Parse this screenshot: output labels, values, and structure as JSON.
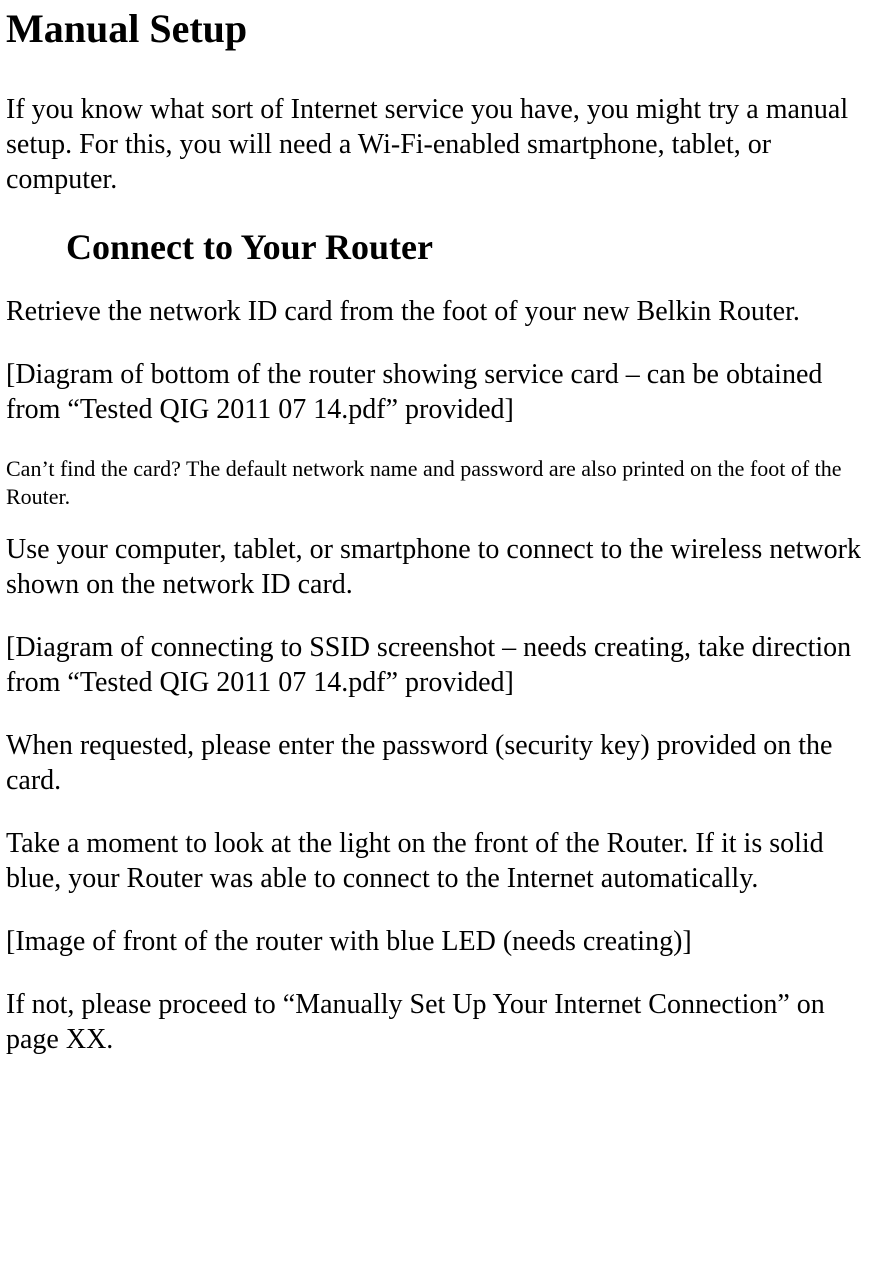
{
  "title": "Manual Setup",
  "intro": "If you know what sort of Internet service you have, you might try a manual setup. For this, you will need a Wi-Fi-enabled smartphone, tablet, or computer.",
  "section_heading": "Connect to Your Router",
  "para1": "Retrieve the network ID card from the foot of your new Belkin Router.",
  "para2": "[Diagram of bottom of the router showing service card – can be obtained from “Tested QIG 2011 07 14.pdf” provided]",
  "note": "Can’t find the card? The default network name and password are also printed on the foot of the Router.",
  "para3": "Use your computer, tablet, or smartphone to connect to the wireless network shown on the network ID card.",
  "para4": "[Diagram of connecting to SSID screenshot – needs creating, take direction from “Tested QIG 2011 07 14.pdf” provided]",
  "para5": "When requested, please enter the password (security key) provided on the card.",
  "para6": "Take a moment to look at the light on the front of the Router. If it is solid blue, your Router was able to connect to the Internet automatically.",
  "para7": "[Image of front of the router with blue LED (needs creating)]",
  "para8": "If not, please proceed to “Manually Set Up Your Internet Connection” on page XX."
}
